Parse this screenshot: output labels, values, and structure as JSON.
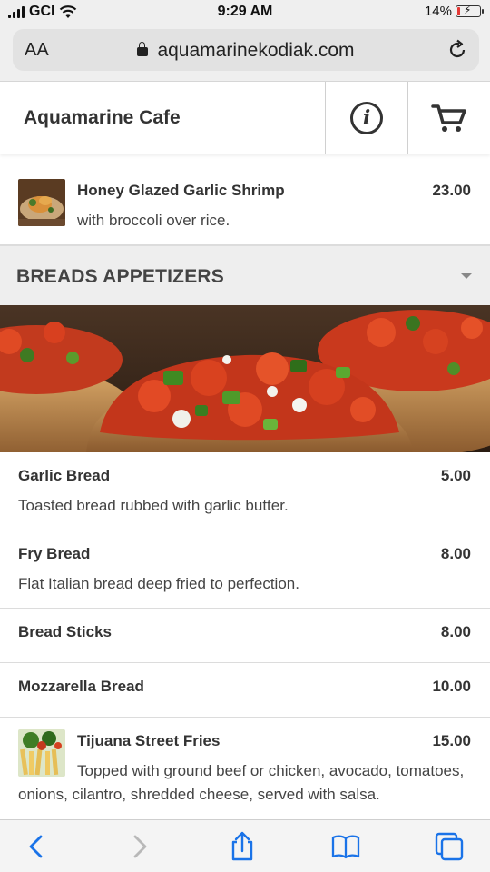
{
  "status_bar": {
    "carrier": "GCI",
    "time": "9:29 AM",
    "battery": "14%",
    "battery_level": 0.14
  },
  "browser": {
    "text_size_label": "AA",
    "url": "aquamarinekodiak.com"
  },
  "header": {
    "brand": "Aquamarine Cafe"
  },
  "top_item": {
    "name": "Honey Glazed Garlic Shrimp",
    "price": "23.00",
    "desc": "with broccoli over rice."
  },
  "section": {
    "title": "BREADS APPETIZERS"
  },
  "items": [
    {
      "name": "Garlic Bread",
      "price": "5.00",
      "desc": "Toasted bread rubbed with garlic butter."
    },
    {
      "name": "Fry Bread",
      "price": "8.00",
      "desc": "Flat Italian bread deep fried to perfection."
    },
    {
      "name": "Bread Sticks",
      "price": "8.00"
    },
    {
      "name": "Mozzarella Bread",
      "price": "10.00"
    },
    {
      "name": "Tijuana Street Fries",
      "price": "15.00",
      "desc": "Topped with ground beef or chicken, avocado, tomatoes, onions, cilantro, shredded cheese, served with salsa."
    }
  ],
  "icons": {
    "info": "info-icon",
    "cart": "cart-icon",
    "back": "back-arrow-icon",
    "forward": "forward-arrow-icon",
    "share": "share-icon",
    "bookmarks": "bookmarks-icon",
    "tabs": "tabs-icon"
  },
  "colors": {
    "accent_blue": "#1a73e8",
    "header_bg": "#ffffff",
    "section_bg": "#eeeeee"
  }
}
